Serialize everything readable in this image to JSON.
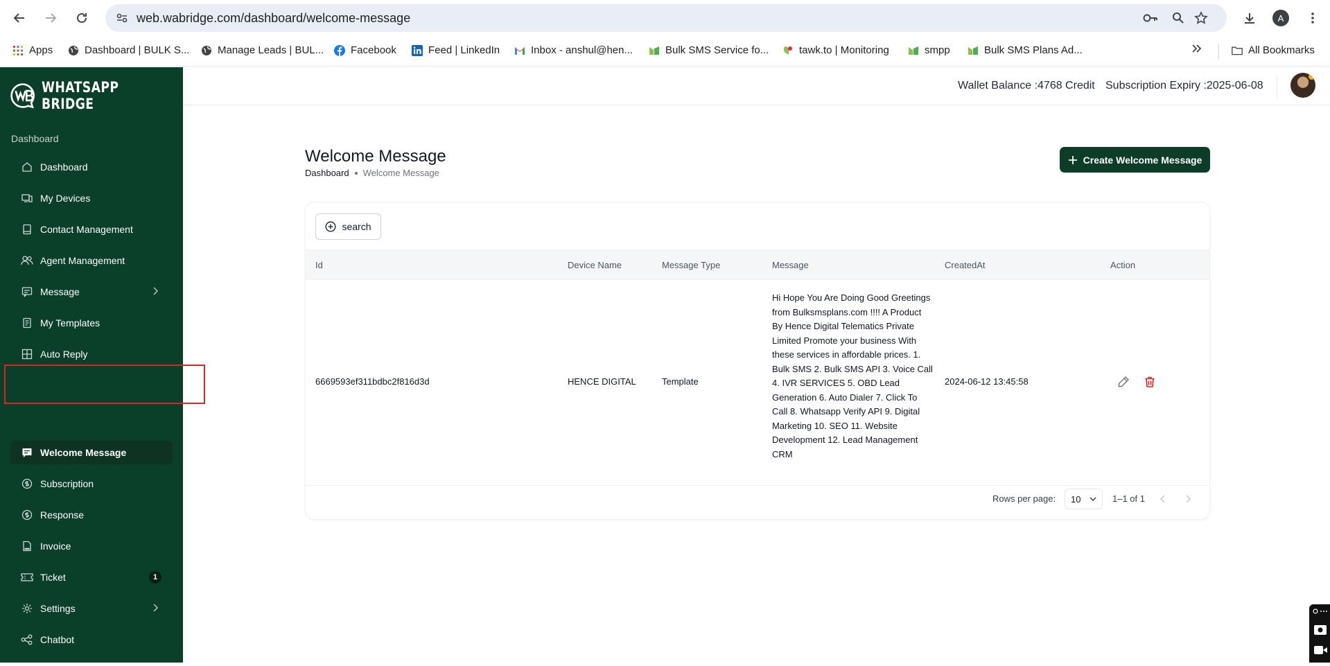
{
  "browser": {
    "url": "web.wabridge.com/dashboard/welcome-message",
    "profile_initial": "A",
    "bookmarks": [
      {
        "label": "Apps",
        "icon": "apps-grid-icon"
      },
      {
        "label": "Dashboard | BULK S...",
        "icon": "globe-icon"
      },
      {
        "label": "Manage Leads | BUL...",
        "icon": "globe-icon"
      },
      {
        "label": "Facebook",
        "icon": "facebook-icon"
      },
      {
        "label": "Feed | LinkedIn",
        "icon": "linkedin-icon"
      },
      {
        "label": "Inbox - anshul@hen...",
        "icon": "gmail-icon"
      },
      {
        "label": "Bulk SMS Service fo...",
        "icon": "bulksms-icon"
      },
      {
        "label": "tawk.to | Monitoring",
        "icon": "tawk-icon"
      },
      {
        "label": "smpp",
        "icon": "bulksms-icon"
      },
      {
        "label": "Bulk SMS Plans Ad...",
        "icon": "bulksms-icon"
      }
    ],
    "all_bookmarks": "All Bookmarks"
  },
  "sidebar": {
    "logo_text": "WHATSAPP BRIDGE",
    "section": "Dashboard",
    "items": [
      {
        "label": "Dashboard",
        "icon": "home-icon"
      },
      {
        "label": "My Devices",
        "icon": "devices-icon"
      },
      {
        "label": "Contact Management",
        "icon": "contact-book-icon"
      },
      {
        "label": "Agent Management",
        "icon": "agents-icon"
      },
      {
        "label": "Message",
        "icon": "message-icon"
      },
      {
        "label": "My Templates",
        "icon": "template-icon"
      },
      {
        "label": "Auto Reply",
        "icon": "grid-icon"
      },
      {
        "label": "Welcome Message",
        "icon": "welcome-chat-icon"
      },
      {
        "label": "Subscription",
        "icon": "dollar-icon"
      },
      {
        "label": "Response",
        "icon": "dollar-icon"
      },
      {
        "label": "Invoice",
        "icon": "pdf-icon"
      },
      {
        "label": "Ticket",
        "icon": "ticket-icon",
        "badge": "1"
      },
      {
        "label": "Settings",
        "icon": "gear-icon"
      },
      {
        "label": "Chatbot",
        "icon": "chatbot-icon"
      }
    ]
  },
  "header": {
    "wallet_label": "Wallet Balance :",
    "wallet_value": "4768 Credit",
    "expiry_label": "Subscription Expiry :",
    "expiry_value": "2025-06-08"
  },
  "main": {
    "title": "Welcome Message",
    "breadcrumb_root": "Dashboard",
    "breadcrumb_current": "Welcome Message",
    "create_label": "Create Welcome Message",
    "search_label": "search",
    "columns": [
      "Id",
      "Device Name",
      "Message Type",
      "Message",
      "CreatedAt",
      "Action"
    ],
    "rows": [
      {
        "id": "6669593ef311bdbc2f816d3d",
        "device": "HENCE DIGITAL",
        "type": "Template",
        "message": "Hi Hope You Are Doing Good Greetings from Bulksmsplans.com !!!! A Product By Hence Digital Telematics Private Limited Promote your business With these services in affordable prices. 1. Bulk SMS 2. Bulk SMS API 3. Voice Call 4. IVR SERVICES 5. OBD Lead Generation 6. Auto Dialer 7. Click To Call 8. Whatsapp Verify API 9. Digital Marketing 10. SEO 11. Website Development 12. Lead Management CRM",
        "created": "2024-06-12 13:45:58"
      }
    ],
    "rows_per_page_label": "Rows per page:",
    "rows_per_page": "10",
    "range": "1–1 of 1"
  },
  "colors": {
    "sidebar_bg": "#0a3f2a",
    "accent": "#0b3d27",
    "delete": "#dc2626",
    "highlight": "#dc2626"
  }
}
